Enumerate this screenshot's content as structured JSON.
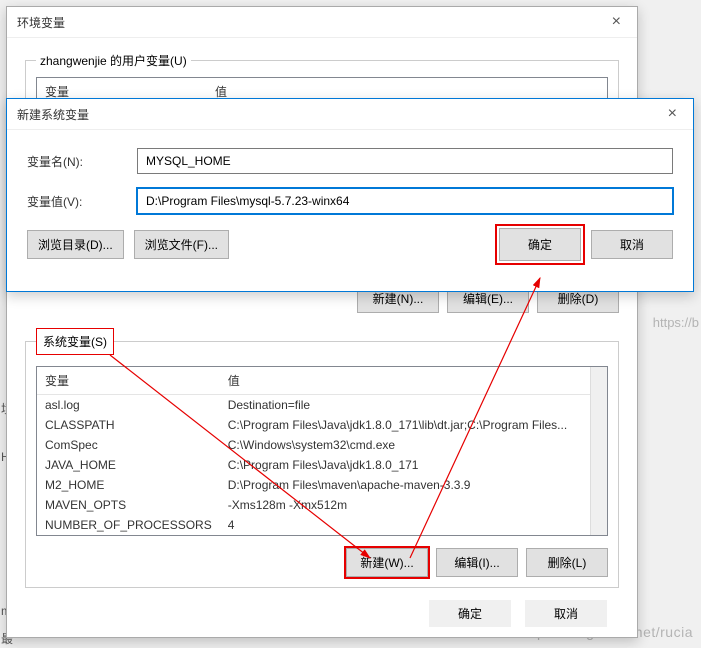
{
  "env_dialog": {
    "title": "环境变量",
    "user_section_label": "zhangwenjie 的用户变量(U)",
    "user_col_var": "变量",
    "user_col_val": "值",
    "sys_section_label": "系统变量(S)",
    "sys_col_var": "变量",
    "sys_col_val": "值",
    "sys_vars": [
      {
        "name": "asl.log",
        "value": "Destination=file"
      },
      {
        "name": "CLASSPATH",
        "value": "C:\\Program Files\\Java\\jdk1.8.0_171\\lib\\dt.jar;C:\\Program Files..."
      },
      {
        "name": "ComSpec",
        "value": "C:\\Windows\\system32\\cmd.exe"
      },
      {
        "name": "JAVA_HOME",
        "value": "C:\\Program Files\\Java\\jdk1.8.0_171"
      },
      {
        "name": "M2_HOME",
        "value": "D:\\Program Files\\maven\\apache-maven-3.3.9"
      },
      {
        "name": "MAVEN_OPTS",
        "value": " -Xms128m -Xmx512m"
      },
      {
        "name": "NUMBER_OF_PROCESSORS",
        "value": "4"
      }
    ],
    "user_btns": {
      "new": "新建(N)...",
      "edit": "编辑(E)...",
      "del": "删除(D)"
    },
    "sys_btns": {
      "new": "新建(W)...",
      "edit": "编辑(I)...",
      "del": "删除(L)"
    },
    "ok": "确定",
    "cancel": "取消"
  },
  "new_dialog": {
    "title": "新建系统变量",
    "name_label": "变量名(N):",
    "name_value": "MYSQL_HOME",
    "value_label": "变量值(V):",
    "value_value": "D:\\Program Files\\mysql-5.7.23-winx64",
    "browse_dir": "浏览目录(D)...",
    "browse_file": "浏览文件(F)...",
    "ok": "确定",
    "cancel": "取消"
  },
  "watermark": "https://blog.csdn.net/rucia",
  "watermark2": "https://b",
  "bg": {
    "frag1": "境",
    "frag2": "H",
    "frag3": "m",
    "frag4": "最"
  }
}
